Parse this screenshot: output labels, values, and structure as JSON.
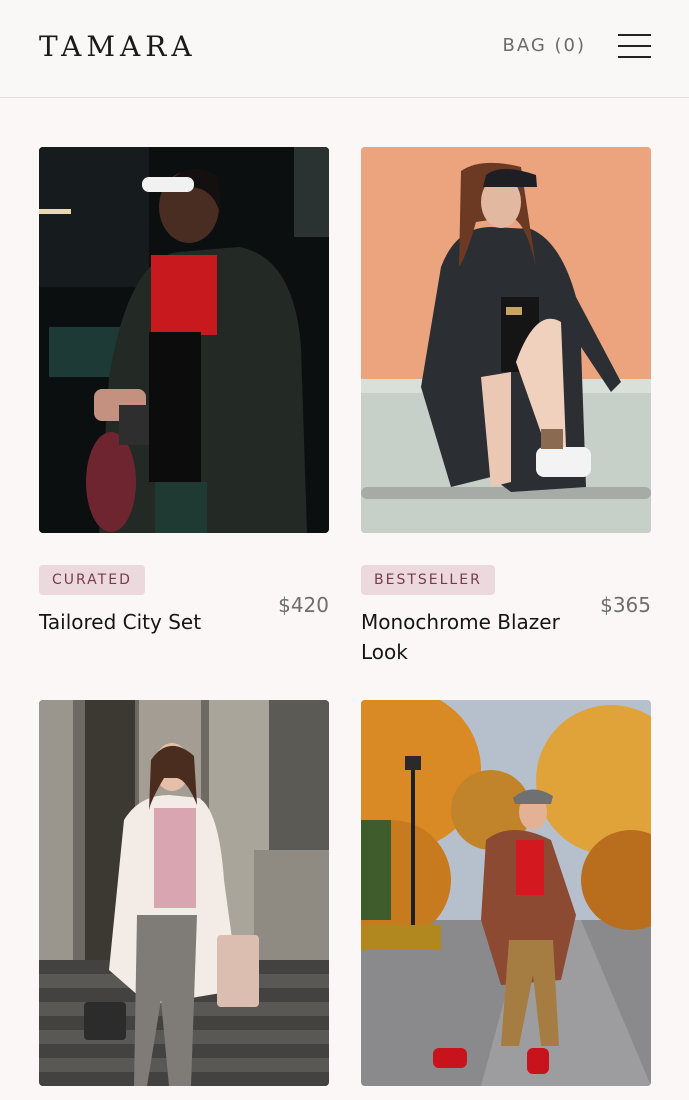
{
  "header": {
    "logo": "TAMARA",
    "bag_label": "BAG (0)",
    "menu_icon": "hamburger-menu-icon"
  },
  "products": [
    {
      "tag": "CURATED",
      "name": "Tailored City Set",
      "price": "$420"
    },
    {
      "tag": "BESTSELLER",
      "name": "Monochrome Blazer Look",
      "price": "$365"
    },
    {
      "tag": "",
      "name": "",
      "price": ""
    },
    {
      "tag": "",
      "name": "",
      "price": ""
    }
  ],
  "colors": {
    "background": "#faf7f6",
    "tag_background": "#ecd9de",
    "tag_text": "#7a3b4e",
    "price_text": "#6e6e6e"
  }
}
